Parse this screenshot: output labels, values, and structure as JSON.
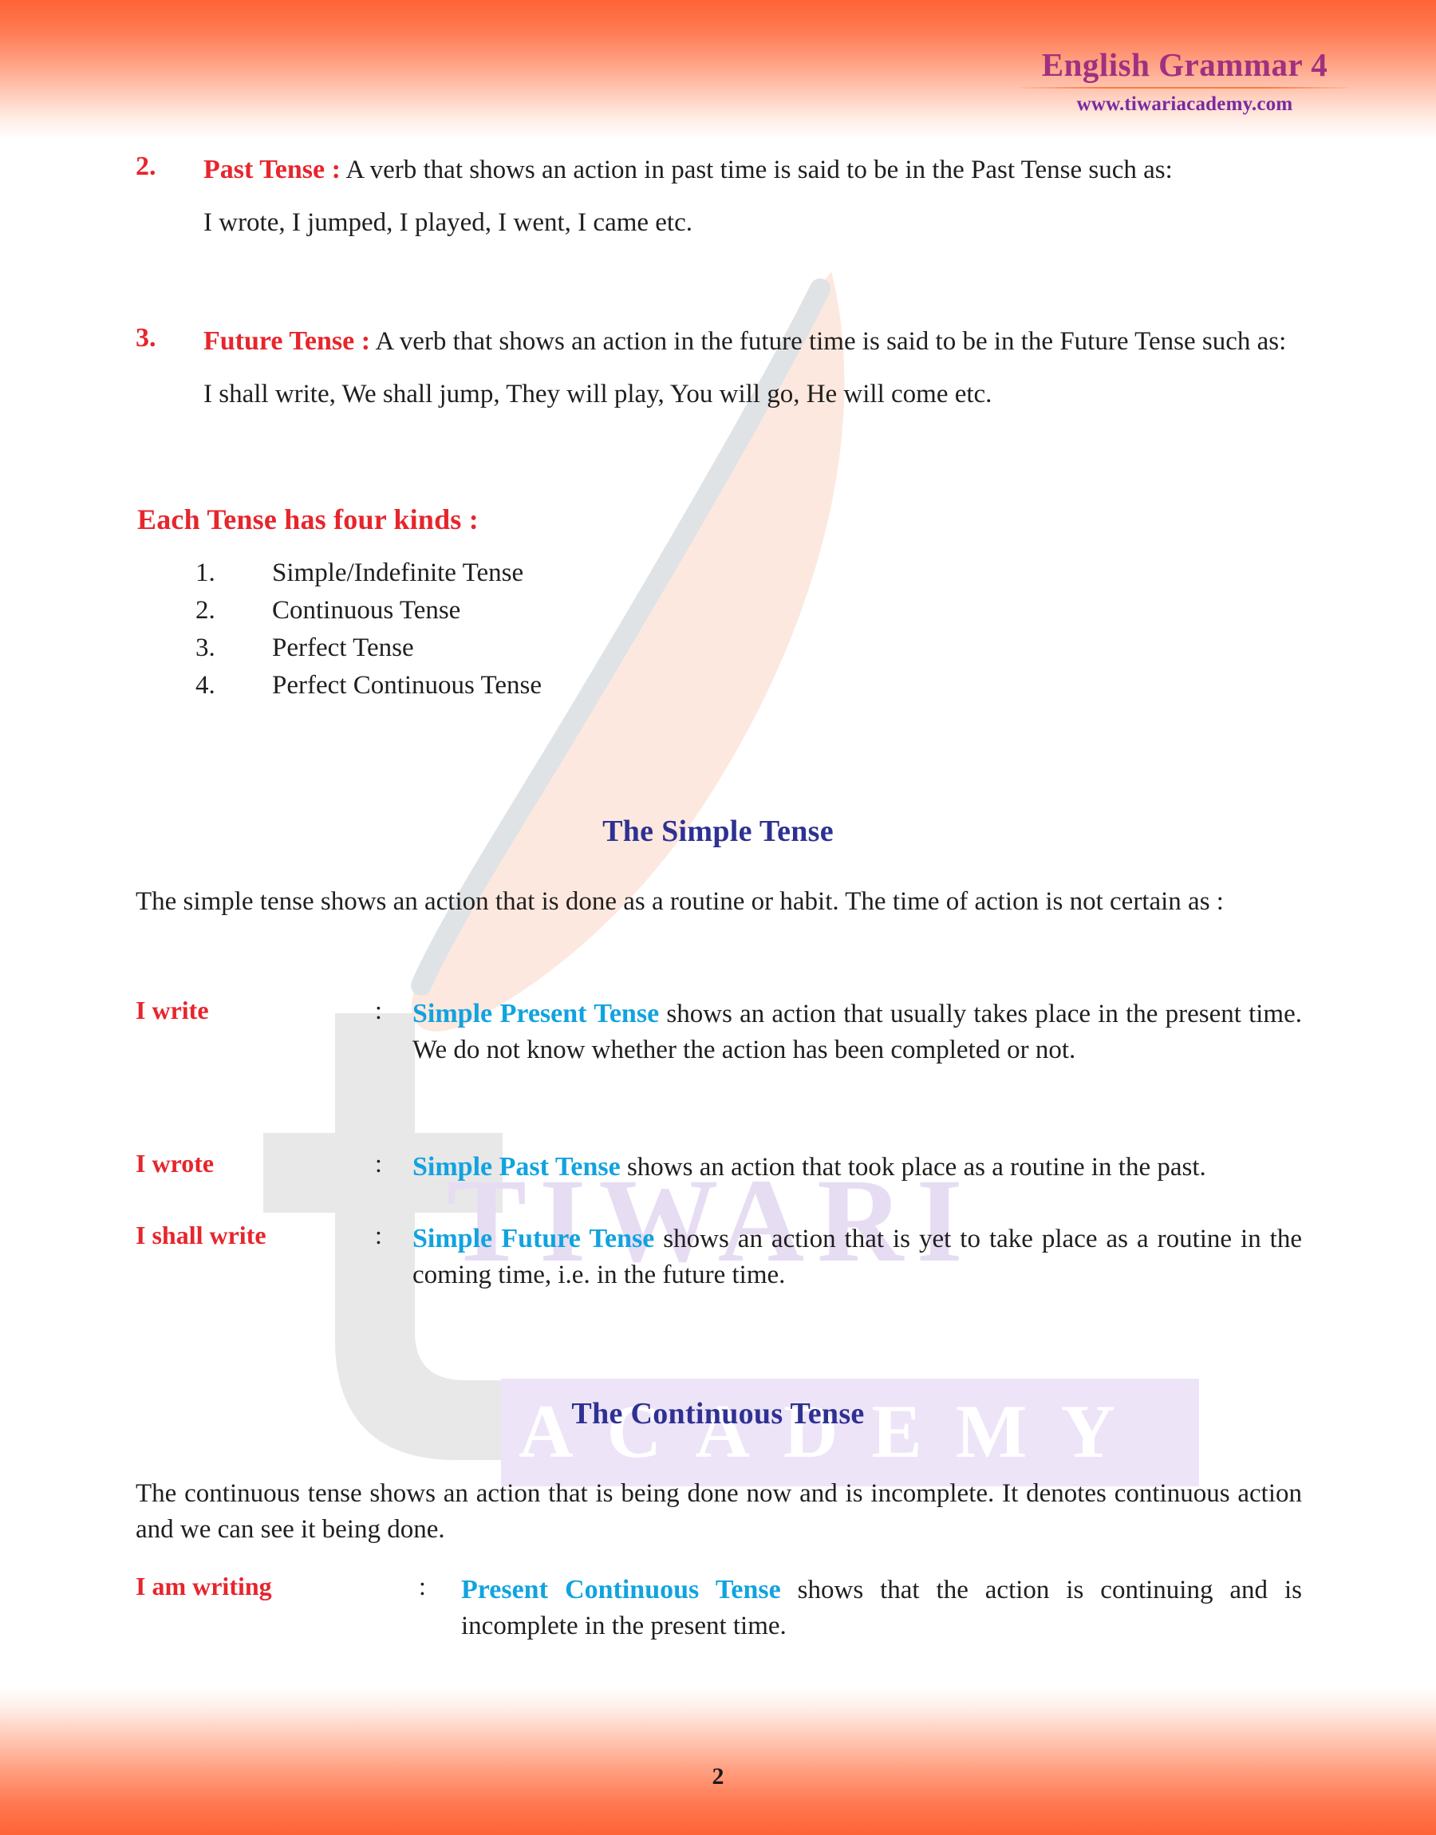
{
  "header": {
    "title": "English Grammar 4",
    "url": "www.tiwariacademy.com"
  },
  "watermark": {
    "brand_top": "TIWARI",
    "brand_bottom": "ACADEMY",
    "logo_letter": "t"
  },
  "tense_items": [
    {
      "number": "2.",
      "lead": "Past Tense :",
      "definition": " A verb that shows an action in past time is said to be in the Past Tense such as:",
      "example": "I wrote, I jumped, I played, I went, I came etc."
    },
    {
      "number": "3.",
      "lead": "Future Tense :",
      "definition": " A verb that shows an action in the future time is said to be in the Future Tense such as:",
      "example": "I shall write, We shall jump, They will play, You will go, He will come etc."
    }
  ],
  "kinds": {
    "heading": "Each Tense has four kinds :",
    "items": [
      {
        "number": "1.",
        "label": "Simple/Indefinite Tense"
      },
      {
        "number": "2.",
        "label": "Continuous Tense"
      },
      {
        "number": "3.",
        "label": "Perfect Tense"
      },
      {
        "number": "4.",
        "label": "Perfect Continuous Tense"
      }
    ]
  },
  "simple_tense": {
    "heading": "The Simple Tense",
    "intro": "The simple tense shows an action that is done as a routine or habit. The time of action is not certain as :",
    "rows": [
      {
        "term": "I write",
        "colon": ":",
        "kind": "Simple Present Tense",
        "desc": " shows an action that usually takes place in the present time. We do not know whether the action has been completed or not."
      },
      {
        "term": "I wrote",
        "colon": ":",
        "kind": "Simple Past Tense",
        "desc": " shows an action that took place as a routine in the past."
      },
      {
        "term": "I shall write",
        "colon": ":",
        "kind": "Simple Future Tense",
        "desc": " shows  an action that is yet to take place as a routine in the coming time, i.e. in the future time."
      }
    ]
  },
  "continuous_tense": {
    "heading": "The Continuous Tense",
    "intro": "The continuous tense shows an action that is being done now and is incomplete. It denotes continuous action and we can see it being done.",
    "rows": [
      {
        "term": "I am writing",
        "colon": ":",
        "kind": "Present Continuous Tense",
        "desc": " shows that the action is continuing and is incomplete in the present time."
      }
    ]
  },
  "footer": {
    "page_number": "2"
  },
  "colors": {
    "accent_red": "#E7252C",
    "accent_cyan": "#11A3DF",
    "heading_blue": "#2E3192",
    "title_purple": "#A03080",
    "url_purple": "#7A2A9E",
    "band_orange": "#FF6336"
  }
}
